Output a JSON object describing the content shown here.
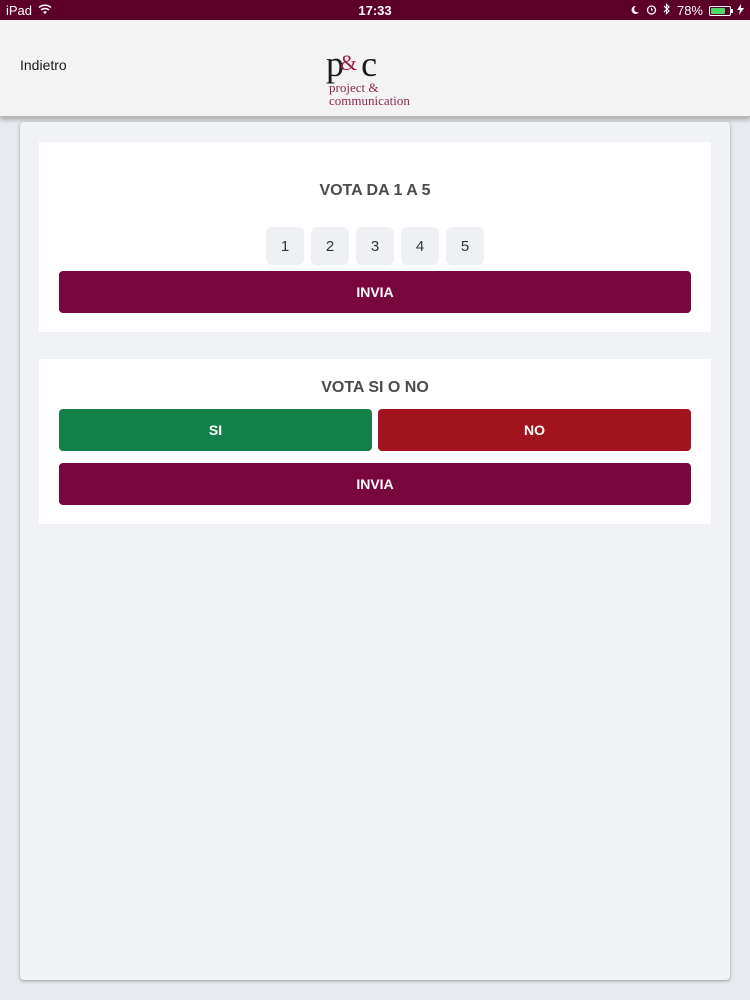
{
  "status_bar": {
    "device": "iPad",
    "time": "17:33",
    "battery_percent": "78%",
    "battery_level": 0.78,
    "icons": [
      "wifi-icon",
      "moon-icon",
      "alarm-icon",
      "bluetooth-icon",
      "battery-icon",
      "charging-icon"
    ],
    "color": "#5d0028"
  },
  "nav": {
    "back_label": "Indietro",
    "logo": {
      "mark": "p",
      "amp": "&",
      "mark2": "c",
      "line1": "project &",
      "line2": "communication"
    }
  },
  "rating_card": {
    "title": "VOTA DA 1 A 5",
    "options": [
      "1",
      "2",
      "3",
      "4",
      "5"
    ],
    "submit_label": "INVIA"
  },
  "yesno_card": {
    "title": "VOTA SI O NO",
    "yes_label": "SI",
    "no_label": "NO",
    "submit_label": "INVIA"
  },
  "colors": {
    "primary": "#7a063e",
    "yes": "#128048",
    "no": "#a1141e"
  }
}
